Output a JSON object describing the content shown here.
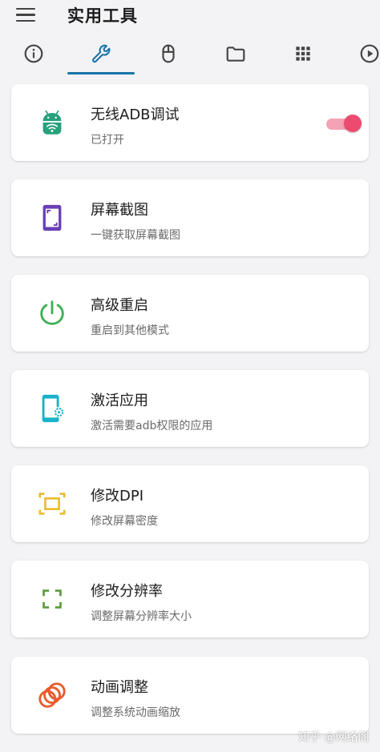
{
  "header": {
    "title": "实用工具"
  },
  "tabs": [
    {
      "name": "info"
    },
    {
      "name": "tools",
      "selected": true
    },
    {
      "name": "mouse"
    },
    {
      "name": "folder"
    },
    {
      "name": "apps"
    },
    {
      "name": "play"
    }
  ],
  "colors": {
    "accent": "#1a73a8",
    "toggle_on": "#ec4b6f"
  },
  "cards": [
    {
      "title": "无线ADB调试",
      "subtitle": "已打开",
      "icon": "android-wifi-icon",
      "icon_color": "#26a17b",
      "toggle_on": true
    },
    {
      "title": "屏幕截图",
      "subtitle": "一键获取屏幕截图",
      "icon": "screenshot-icon",
      "icon_color": "#6a3fb5"
    },
    {
      "title": "高级重启",
      "subtitle": "重启到其他模式",
      "icon": "power-icon",
      "icon_color": "#3fae53"
    },
    {
      "title": "激活应用",
      "subtitle": "激活需要adb权限的应用",
      "icon": "phone-settings-icon",
      "icon_color": "#19b3c9"
    },
    {
      "title": "修改DPI",
      "subtitle": "修改屏幕密度",
      "icon": "dpi-frame-icon",
      "icon_color": "#e9b823"
    },
    {
      "title": "修改分辨率",
      "subtitle": "调整屏幕分辨率大小",
      "icon": "resolution-icon",
      "icon_color": "#5b9a3a"
    },
    {
      "title": "动画调整",
      "subtitle": "调整系统动画缩放",
      "icon": "animation-rings-icon",
      "icon_color": "#ea5a2c"
    }
  ],
  "watermark": "知乎 @网络阁"
}
